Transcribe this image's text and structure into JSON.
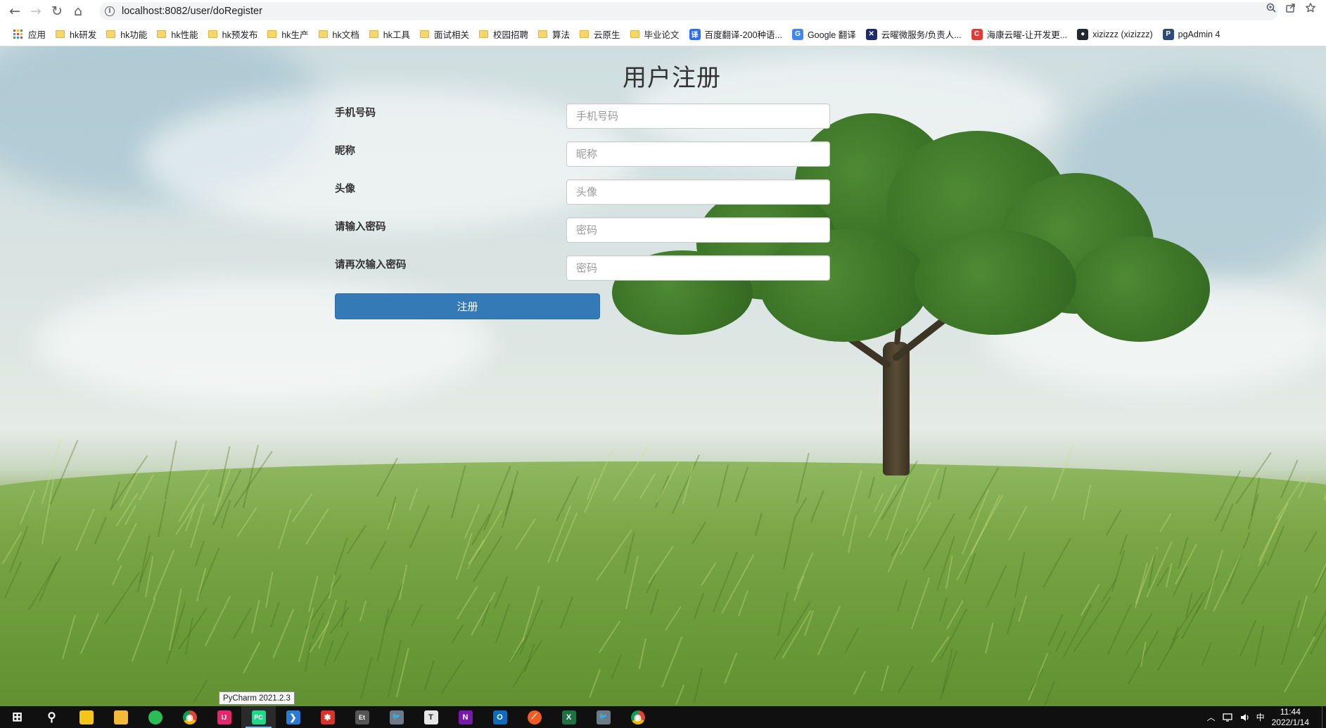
{
  "browser": {
    "url": "localhost:8082/user/doRegister",
    "nav": {
      "back": "←",
      "forward": "→",
      "reload": "↻",
      "home": "⌂"
    },
    "bookmarks": [
      {
        "label": "应用",
        "icon": "apps-grid-icon"
      },
      {
        "label": "hk研发",
        "icon": "folder-icon"
      },
      {
        "label": "hk功能",
        "icon": "folder-icon"
      },
      {
        "label": "hk性能",
        "icon": "folder-icon"
      },
      {
        "label": "hk预发布",
        "icon": "folder-icon"
      },
      {
        "label": "hk生产",
        "icon": "folder-icon"
      },
      {
        "label": "hk文档",
        "icon": "folder-icon"
      },
      {
        "label": "hk工具",
        "icon": "folder-icon"
      },
      {
        "label": "面试相关",
        "icon": "folder-icon"
      },
      {
        "label": "校园招聘",
        "icon": "folder-icon"
      },
      {
        "label": "算法",
        "icon": "folder-icon"
      },
      {
        "label": "云原生",
        "icon": "folder-icon"
      },
      {
        "label": "毕业论文",
        "icon": "folder-icon"
      },
      {
        "label": "百度翻译-200种语...",
        "icon": "baidu-translate-icon"
      },
      {
        "label": "Google 翻译",
        "icon": "google-translate-icon"
      },
      {
        "label": "云曜微服务/负责人...",
        "icon": "cloud-service-icon"
      },
      {
        "label": "海康云曜-让开发更...",
        "icon": "hikvision-icon"
      },
      {
        "label": "xizizzz (xizizzz)",
        "icon": "github-icon"
      },
      {
        "label": "pgAdmin 4",
        "icon": "pgadmin-icon"
      }
    ]
  },
  "form": {
    "title": "用户注册",
    "fields": [
      {
        "label": "手机号码",
        "placeholder": "手机号码"
      },
      {
        "label": "昵称",
        "placeholder": "昵称"
      },
      {
        "label": "头像",
        "placeholder": "头像"
      },
      {
        "label": "请输入密码",
        "placeholder": "密码"
      },
      {
        "label": "请再次输入密码",
        "placeholder": "密码"
      }
    ],
    "submit_label": "注册"
  },
  "tooltip": "PyCharm 2021.2.3",
  "taskbar": {
    "apps": [
      {
        "name": "start",
        "icon": "windows-start-icon"
      },
      {
        "name": "search",
        "icon": "search-icon"
      },
      {
        "name": "sticky-notes",
        "icon": "sticky-notes-icon"
      },
      {
        "name": "file-explorer",
        "icon": "folder-icon"
      },
      {
        "name": "app-green",
        "icon": "green-app-icon"
      },
      {
        "name": "chrome",
        "icon": "chrome-icon"
      },
      {
        "name": "intellij",
        "icon": "intellij-icon"
      },
      {
        "name": "pycharm",
        "icon": "pycharm-icon"
      },
      {
        "name": "vscode",
        "icon": "vscode-icon"
      },
      {
        "name": "app-red",
        "icon": "red-app-icon"
      },
      {
        "name": "app-et",
        "icon": "et-app-icon"
      },
      {
        "name": "app-bird",
        "icon": "bird-app-icon"
      },
      {
        "name": "typora",
        "icon": "typora-icon"
      },
      {
        "name": "onenote",
        "icon": "onenote-icon"
      },
      {
        "name": "outlook",
        "icon": "outlook-icon"
      },
      {
        "name": "postman",
        "icon": "postman-icon"
      },
      {
        "name": "excel",
        "icon": "excel-icon"
      },
      {
        "name": "app-bird-2",
        "icon": "bird-app-icon"
      },
      {
        "name": "chrome-2",
        "icon": "chrome-icon"
      }
    ],
    "ime": "中",
    "time": "11:44",
    "date": "2022/1/14"
  }
}
